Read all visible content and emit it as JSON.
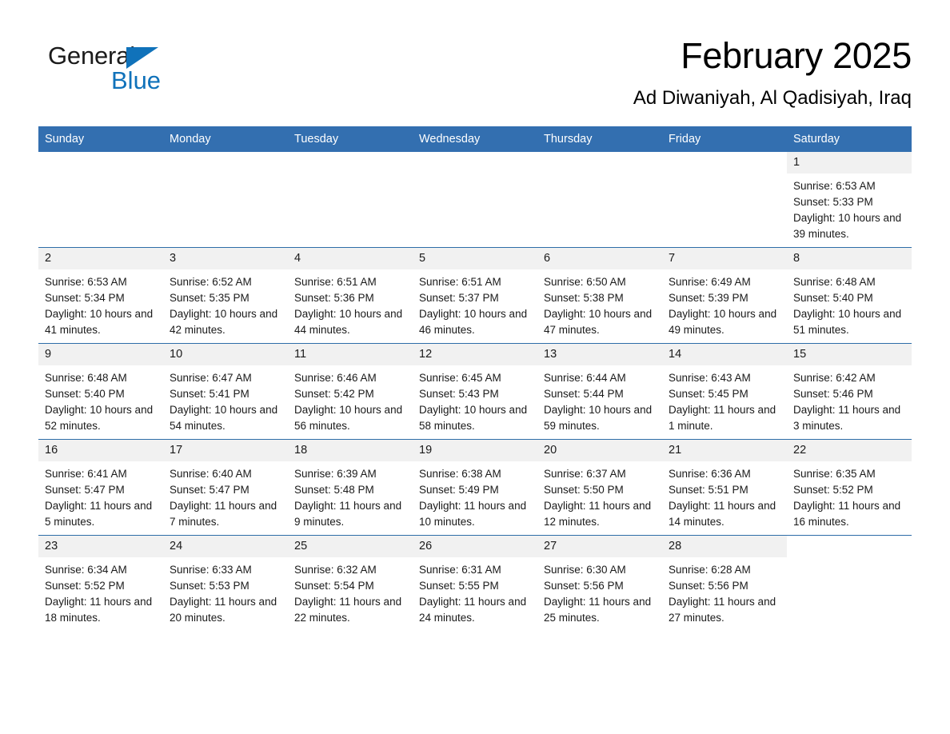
{
  "brand": {
    "name_part1": "General",
    "name_part2": "Blue",
    "accent_color": "#1072ba"
  },
  "header": {
    "month_title": "February 2025",
    "location": "Ad Diwaniyah, Al Qadisiyah, Iraq",
    "header_bg_color": "#336fb0",
    "daynum_bg_color": "#f1f1f1"
  },
  "weekday_headers": [
    "Sunday",
    "Monday",
    "Tuesday",
    "Wednesday",
    "Thursday",
    "Friday",
    "Saturday"
  ],
  "labels": {
    "sunrise_prefix": "Sunrise:",
    "sunset_prefix": "Sunset:",
    "daylight_prefix": "Daylight:"
  },
  "weeks": [
    [
      {
        "day": "",
        "blank": true
      },
      {
        "day": "",
        "blank": true
      },
      {
        "day": "",
        "blank": true
      },
      {
        "day": "",
        "blank": true
      },
      {
        "day": "",
        "blank": true
      },
      {
        "day": "",
        "blank": true
      },
      {
        "day": "1",
        "sunrise": "Sunrise: 6:53 AM",
        "sunset": "Sunset: 5:33 PM",
        "daylight": "Daylight: 10 hours and 39 minutes."
      }
    ],
    [
      {
        "day": "2",
        "sunrise": "Sunrise: 6:53 AM",
        "sunset": "Sunset: 5:34 PM",
        "daylight": "Daylight: 10 hours and 41 minutes."
      },
      {
        "day": "3",
        "sunrise": "Sunrise: 6:52 AM",
        "sunset": "Sunset: 5:35 PM",
        "daylight": "Daylight: 10 hours and 42 minutes."
      },
      {
        "day": "4",
        "sunrise": "Sunrise: 6:51 AM",
        "sunset": "Sunset: 5:36 PM",
        "daylight": "Daylight: 10 hours and 44 minutes."
      },
      {
        "day": "5",
        "sunrise": "Sunrise: 6:51 AM",
        "sunset": "Sunset: 5:37 PM",
        "daylight": "Daylight: 10 hours and 46 minutes."
      },
      {
        "day": "6",
        "sunrise": "Sunrise: 6:50 AM",
        "sunset": "Sunset: 5:38 PM",
        "daylight": "Daylight: 10 hours and 47 minutes."
      },
      {
        "day": "7",
        "sunrise": "Sunrise: 6:49 AM",
        "sunset": "Sunset: 5:39 PM",
        "daylight": "Daylight: 10 hours and 49 minutes."
      },
      {
        "day": "8",
        "sunrise": "Sunrise: 6:48 AM",
        "sunset": "Sunset: 5:40 PM",
        "daylight": "Daylight: 10 hours and 51 minutes."
      }
    ],
    [
      {
        "day": "9",
        "sunrise": "Sunrise: 6:48 AM",
        "sunset": "Sunset: 5:40 PM",
        "daylight": "Daylight: 10 hours and 52 minutes."
      },
      {
        "day": "10",
        "sunrise": "Sunrise: 6:47 AM",
        "sunset": "Sunset: 5:41 PM",
        "daylight": "Daylight: 10 hours and 54 minutes."
      },
      {
        "day": "11",
        "sunrise": "Sunrise: 6:46 AM",
        "sunset": "Sunset: 5:42 PM",
        "daylight": "Daylight: 10 hours and 56 minutes."
      },
      {
        "day": "12",
        "sunrise": "Sunrise: 6:45 AM",
        "sunset": "Sunset: 5:43 PM",
        "daylight": "Daylight: 10 hours and 58 minutes."
      },
      {
        "day": "13",
        "sunrise": "Sunrise: 6:44 AM",
        "sunset": "Sunset: 5:44 PM",
        "daylight": "Daylight: 10 hours and 59 minutes."
      },
      {
        "day": "14",
        "sunrise": "Sunrise: 6:43 AM",
        "sunset": "Sunset: 5:45 PM",
        "daylight": "Daylight: 11 hours and 1 minute."
      },
      {
        "day": "15",
        "sunrise": "Sunrise: 6:42 AM",
        "sunset": "Sunset: 5:46 PM",
        "daylight": "Daylight: 11 hours and 3 minutes."
      }
    ],
    [
      {
        "day": "16",
        "sunrise": "Sunrise: 6:41 AM",
        "sunset": "Sunset: 5:47 PM",
        "daylight": "Daylight: 11 hours and 5 minutes."
      },
      {
        "day": "17",
        "sunrise": "Sunrise: 6:40 AM",
        "sunset": "Sunset: 5:47 PM",
        "daylight": "Daylight: 11 hours and 7 minutes."
      },
      {
        "day": "18",
        "sunrise": "Sunrise: 6:39 AM",
        "sunset": "Sunset: 5:48 PM",
        "daylight": "Daylight: 11 hours and 9 minutes."
      },
      {
        "day": "19",
        "sunrise": "Sunrise: 6:38 AM",
        "sunset": "Sunset: 5:49 PM",
        "daylight": "Daylight: 11 hours and 10 minutes."
      },
      {
        "day": "20",
        "sunrise": "Sunrise: 6:37 AM",
        "sunset": "Sunset: 5:50 PM",
        "daylight": "Daylight: 11 hours and 12 minutes."
      },
      {
        "day": "21",
        "sunrise": "Sunrise: 6:36 AM",
        "sunset": "Sunset: 5:51 PM",
        "daylight": "Daylight: 11 hours and 14 minutes."
      },
      {
        "day": "22",
        "sunrise": "Sunrise: 6:35 AM",
        "sunset": "Sunset: 5:52 PM",
        "daylight": "Daylight: 11 hours and 16 minutes."
      }
    ],
    [
      {
        "day": "23",
        "sunrise": "Sunrise: 6:34 AM",
        "sunset": "Sunset: 5:52 PM",
        "daylight": "Daylight: 11 hours and 18 minutes."
      },
      {
        "day": "24",
        "sunrise": "Sunrise: 6:33 AM",
        "sunset": "Sunset: 5:53 PM",
        "daylight": "Daylight: 11 hours and 20 minutes."
      },
      {
        "day": "25",
        "sunrise": "Sunrise: 6:32 AM",
        "sunset": "Sunset: 5:54 PM",
        "daylight": "Daylight: 11 hours and 22 minutes."
      },
      {
        "day": "26",
        "sunrise": "Sunrise: 6:31 AM",
        "sunset": "Sunset: 5:55 PM",
        "daylight": "Daylight: 11 hours and 24 minutes."
      },
      {
        "day": "27",
        "sunrise": "Sunrise: 6:30 AM",
        "sunset": "Sunset: 5:56 PM",
        "daylight": "Daylight: 11 hours and 25 minutes."
      },
      {
        "day": "28",
        "sunrise": "Sunrise: 6:28 AM",
        "sunset": "Sunset: 5:56 PM",
        "daylight": "Daylight: 11 hours and 27 minutes."
      },
      {
        "day": "",
        "blank": true
      }
    ]
  ]
}
